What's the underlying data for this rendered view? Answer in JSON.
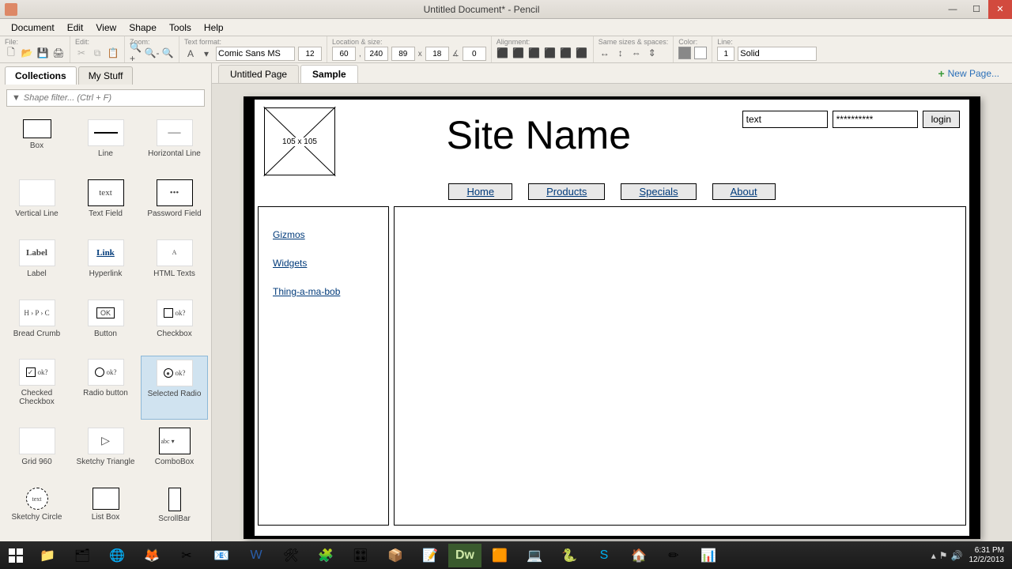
{
  "window": {
    "title": "Untitled Document* - Pencil"
  },
  "menu": {
    "items": [
      "Document",
      "Edit",
      "View",
      "Shape",
      "Tools",
      "Help"
    ]
  },
  "toolbar": {
    "groups": {
      "file": "File:",
      "edit": "Edit:",
      "zoom": "Zoom:",
      "text": "Text format:",
      "loc": "Location & size:",
      "align": "Alignment:",
      "same": "Same sizes & spaces:",
      "color": "Color:",
      "line": "Line:"
    },
    "font": "Comic Sans MS",
    "fontsize": "12",
    "x": "60",
    "y": "240",
    "w": "89",
    "h": "18",
    "r": "0",
    "line_width": "1",
    "line_style": "Solid"
  },
  "sidebar": {
    "tabs": {
      "collections": "Collections",
      "mystuff": "My Stuff"
    },
    "filter_placeholder": "Shape filter... (Ctrl + F)",
    "shapes": [
      {
        "name": "Box",
        "key": "box",
        "t": ""
      },
      {
        "name": "Line",
        "key": "line",
        "t": ""
      },
      {
        "name": "Horizontal Line",
        "key": "hline",
        "t": ""
      },
      {
        "name": "Vertical Line",
        "key": "vline",
        "t": ""
      },
      {
        "name": "Text Field",
        "key": "tf",
        "t": "text"
      },
      {
        "name": "Password Field",
        "key": "pw",
        "t": "•••"
      },
      {
        "name": "Label",
        "key": "label",
        "t": "Label"
      },
      {
        "name": "Hyperlink",
        "key": "link",
        "t": "Link"
      },
      {
        "name": "HTML Texts",
        "key": "html",
        "t": "A"
      },
      {
        "name": "Bread Crumb",
        "key": "bc",
        "t": "H › P › C"
      },
      {
        "name": "Button",
        "key": "btn",
        "t": "OK"
      },
      {
        "name": "Checkbox",
        "key": "cb",
        "t": "ok?"
      },
      {
        "name": "Checked Checkbox",
        "key": "ccb",
        "t": "ok?"
      },
      {
        "name": "Radio button",
        "key": "rb",
        "t": "ok?"
      },
      {
        "name": "Selected Radio",
        "key": "srb",
        "t": "ok?",
        "sel": true
      },
      {
        "name": "Grid 960",
        "key": "grid",
        "t": ""
      },
      {
        "name": "Sketchy Triangle",
        "key": "tri",
        "t": ""
      },
      {
        "name": "ComboBox",
        "key": "combo",
        "t": "abc ▾"
      },
      {
        "name": "Sketchy Circle",
        "key": "circ",
        "t": "text"
      },
      {
        "name": "List Box",
        "key": "lb",
        "t": ""
      },
      {
        "name": "ScrollBar",
        "key": "sb",
        "t": ""
      }
    ]
  },
  "pages": {
    "tabs": [
      {
        "label": "Untitled Page",
        "active": false
      },
      {
        "label": "Sample",
        "active": true
      }
    ],
    "new_page": "New Page..."
  },
  "mockup": {
    "image_label": "105 x 105",
    "site_title": "Site Name",
    "login": {
      "user_value": "text",
      "pass_value": "**********",
      "button": "login"
    },
    "nav": [
      "Home",
      "Products",
      "Specials",
      "About"
    ],
    "side_links": [
      "Gizmos",
      "Widgets",
      "Thing-a-ma-bob"
    ]
  },
  "taskbar": {
    "time": "6:31 PM",
    "date": "12/2/2013"
  }
}
